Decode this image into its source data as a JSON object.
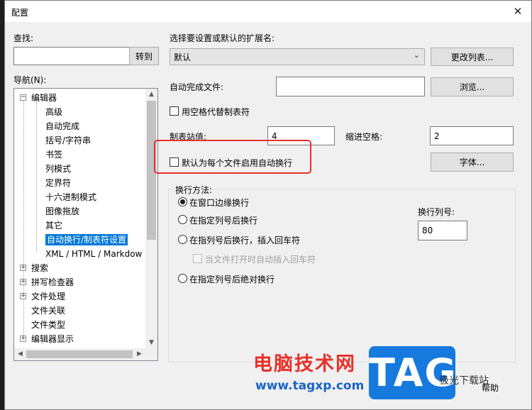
{
  "window": {
    "title": "配置",
    "close_glyph": "✕"
  },
  "search": {
    "label": "查找:",
    "value": "",
    "goto_label": "转到"
  },
  "nav": {
    "label": "导航(N):",
    "items": [
      {
        "label": "编辑器",
        "level": 0,
        "expander": "⊟"
      },
      {
        "label": "高级",
        "level": 1
      },
      {
        "label": "自动完成",
        "level": 1
      },
      {
        "label": "括号/字符串",
        "level": 1
      },
      {
        "label": "书签",
        "level": 1
      },
      {
        "label": "列模式",
        "level": 1
      },
      {
        "label": "定界符",
        "level": 1
      },
      {
        "label": "十六进制模式",
        "level": 1
      },
      {
        "label": "图像拖放",
        "level": 1
      },
      {
        "label": "其它",
        "level": 1
      },
      {
        "label": "自动换行/制表符设置",
        "level": 1,
        "selected": true
      },
      {
        "label": "XML / HTML / Markdow",
        "level": 1
      },
      {
        "label": "搜索",
        "level": 0,
        "expander": "⊞"
      },
      {
        "label": "拼写检查器",
        "level": 0,
        "expander": "⊞"
      },
      {
        "label": "文件处理",
        "level": 0,
        "expander": "⊞"
      },
      {
        "label": "文件关联",
        "level": 0
      },
      {
        "label": "文件类型",
        "level": 0
      },
      {
        "label": "编辑器显示",
        "level": 0,
        "expander": "⊞"
      }
    ]
  },
  "extension": {
    "label": "选择要设置或默认的扩展名:",
    "selected": "默认",
    "change_list_label": "更改列表..."
  },
  "autocomplete_file": {
    "label": "自动完成文件:",
    "value": "",
    "browse_label": "浏览..."
  },
  "use_spaces": {
    "label": "用空格代替制表符",
    "checked": false
  },
  "tab_stop": {
    "label": "制表站值:",
    "value": "4"
  },
  "indent": {
    "label": "缩进空格:",
    "value": "2"
  },
  "default_wrap": {
    "label": "默认为每个文件启用自动换行",
    "checked": false
  },
  "font_button": {
    "label": "字体..."
  },
  "wrap_method": {
    "label": "换行方法:",
    "options": [
      {
        "label": "在窗口边缘换行",
        "checked": true
      },
      {
        "label": "在指定列号后换行",
        "checked": false
      },
      {
        "label": "在指列号后换行，插入回车符",
        "checked": false
      },
      {
        "label": "在指定列号后绝对换行",
        "checked": false
      }
    ],
    "insert_on_open": {
      "label": "当文件打开时自动插入回车符",
      "checked": false,
      "disabled": true
    },
    "wrap_column": {
      "label": "换行列号:",
      "value": "80"
    }
  },
  "help": {
    "label": "帮助"
  },
  "watermark": {
    "text": "电脑技术网",
    "url": "www.tagxp.com",
    "logo": "TAG",
    "badge": "极光下载站"
  },
  "colors": {
    "highlight": "#e8302a",
    "selection": "#0078d7",
    "logo": "#1679dd"
  }
}
